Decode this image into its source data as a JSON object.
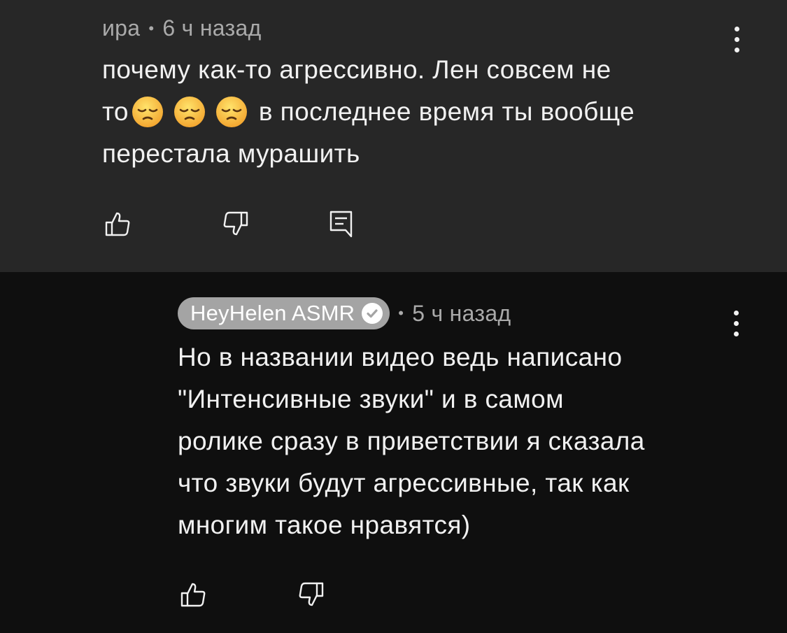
{
  "comment": {
    "author": "ира",
    "separator": "•",
    "time": "6 ч назад",
    "text_line1": "почему как-то агрессивно. Лен совсем не",
    "text_line2_start": "то",
    "emojis": [
      "pensive-face",
      "pensive-face",
      "pensive-face"
    ],
    "text_line2_end": "в последнее время ты вообще",
    "text_line3": "перестала мурашить"
  },
  "reply": {
    "author": "HeyHelen ASMR",
    "verified": true,
    "separator": "•",
    "time": "5 ч назад",
    "lines": [
      "Но в названии видео ведь написано",
      "\"Интенсивные звуки\" и в самом",
      "ролике сразу в приветствии я сказала",
      "что звуки будут агрессивные, так как",
      "многим такое нравятся)"
    ]
  },
  "colors": {
    "top_background": "#272727",
    "reply_background": "#0f0f0f",
    "text": "#f1f1f1",
    "meta_text": "#aaaaaa",
    "channel_pill": "#a4a4a4"
  }
}
